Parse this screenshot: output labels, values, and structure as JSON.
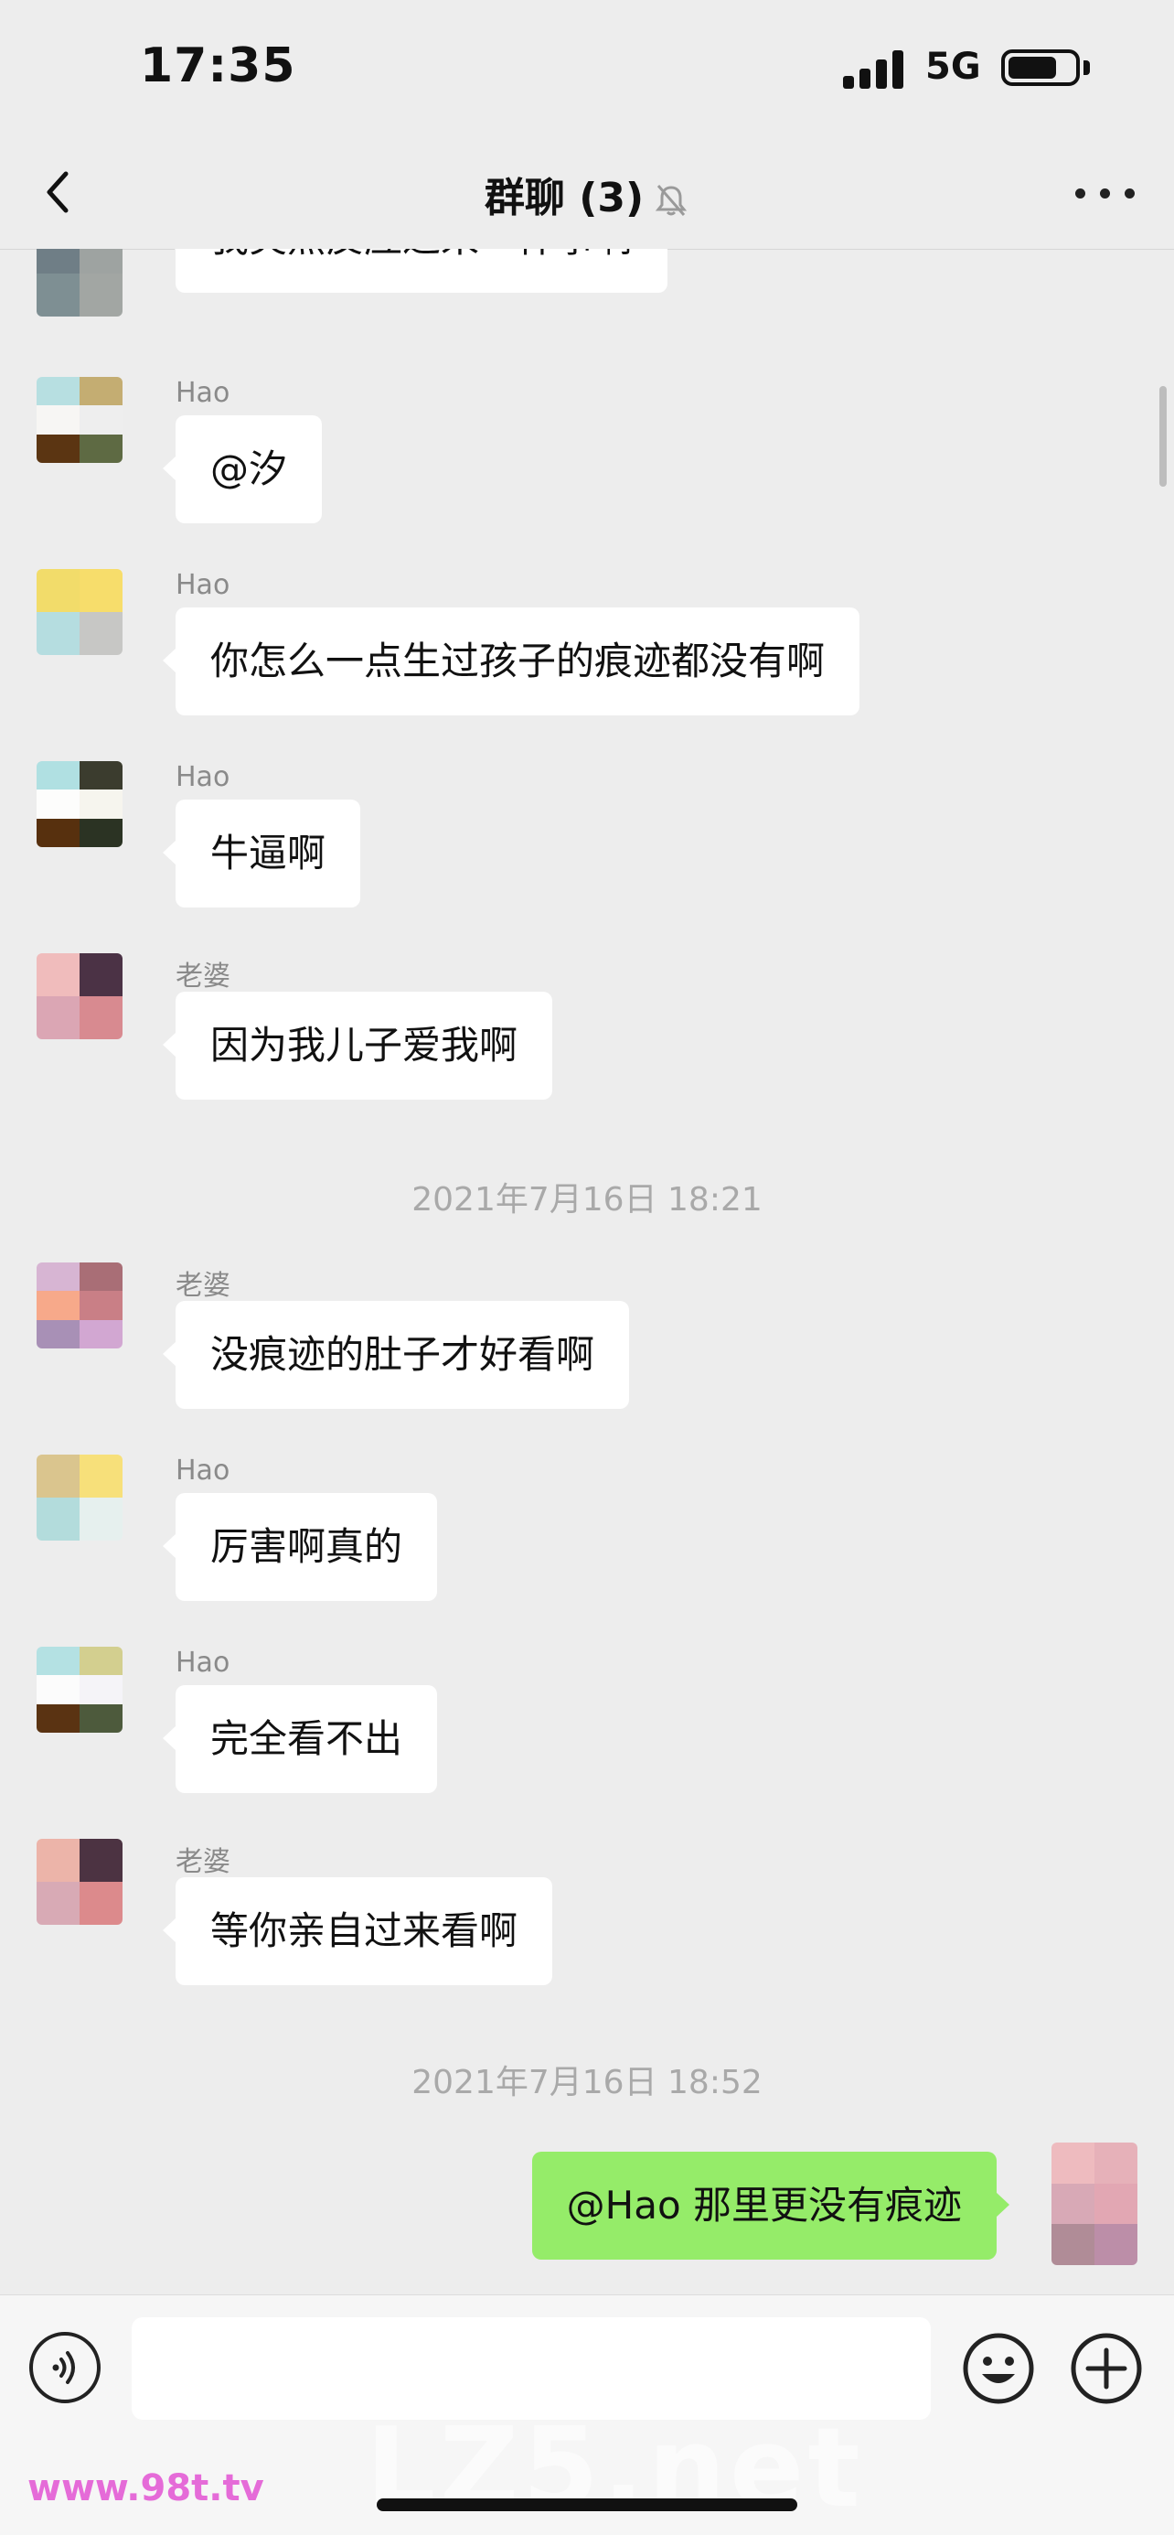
{
  "status": {
    "time": "17:35",
    "network": "5G"
  },
  "nav": {
    "title": "群聊 (3)"
  },
  "messages": [
    {
      "sender": "",
      "text": "我突然反应过来一件事啊"
    },
    {
      "sender": "Hao",
      "text": "@汐"
    },
    {
      "sender": "Hao",
      "text": "你怎么一点生过孩子的痕迹都没有啊"
    },
    {
      "sender": "Hao",
      "text": "牛逼啊"
    },
    {
      "sender": "老婆",
      "text": "因为我儿子爱我啊"
    },
    {
      "timestamp": "2021年7月16日 18:21"
    },
    {
      "sender": "老婆",
      "text": "没痕迹的肚子才好看啊"
    },
    {
      "sender": "Hao",
      "text": "厉害啊真的"
    },
    {
      "sender": "Hao",
      "text": "完全看不出"
    },
    {
      "sender": "老婆",
      "text": "等你亲自过来看啊"
    },
    {
      "timestamp": "2021年7月16日 18:52"
    },
    {
      "sender": "me",
      "text": "@Hao 那里更没有痕迹"
    }
  ],
  "input": {
    "value": "",
    "placeholder": ""
  },
  "watermark": {
    "main": "LZ5.net",
    "left": "www.98t.tv"
  },
  "colors": {
    "background": "#ededed",
    "outgoing_bubble": "#95ec69",
    "incoming_bubble": "#ffffff"
  }
}
